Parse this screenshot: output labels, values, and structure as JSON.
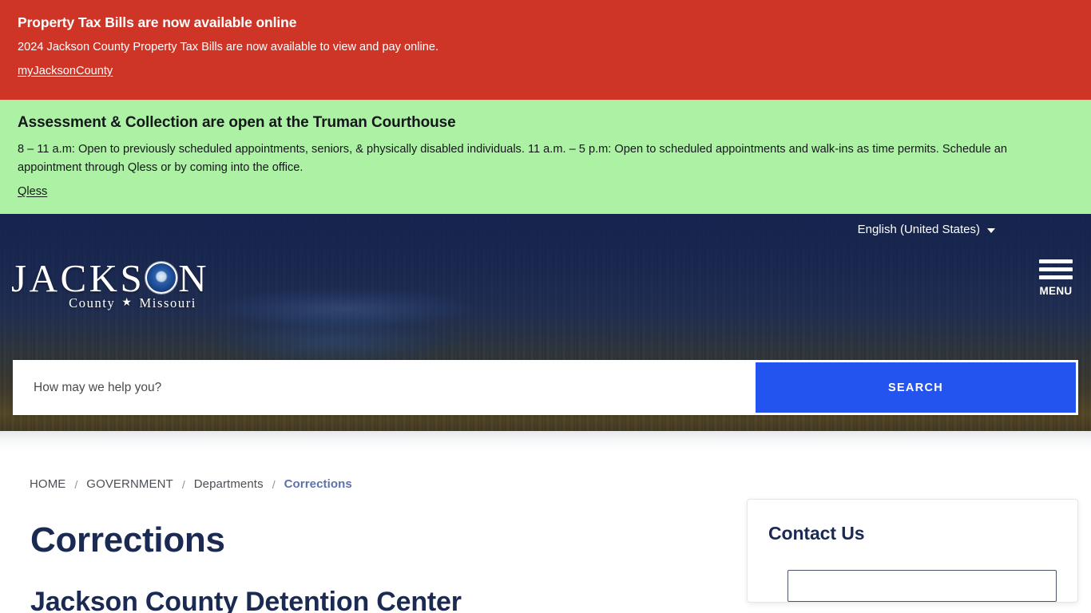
{
  "alerts": [
    {
      "id": "property-tax",
      "title": "Property Tax Bills are now available online",
      "body": "2024 Jackson County Property Tax Bills are now available to view and pay online.",
      "link": "myJacksonCounty",
      "background": "#cf3527",
      "text_color": "#ffffff"
    },
    {
      "id": "assessment-collection",
      "title": "Assessment & Collection are open at the Truman Courthouse",
      "body": "8 – 11 a.m: Open to previously scheduled appointments, seniors, & physically disabled individuals. 11 a.m. – 5 p.m: Open to scheduled appointments and walk-ins as time permits. Schedule an appointment through Qless or by coming into the office.",
      "link": "Qless",
      "background": "#adf2a4",
      "text_color": "#14171a"
    }
  ],
  "header": {
    "language": {
      "selected": "English (United States)",
      "caret_icon": "chevron-down-icon"
    },
    "logo": {
      "word_before_seal": "JACKS",
      "seal_icon": "jackson-county-seal-icon",
      "word_after_seal": "N",
      "subtitle_left": "County",
      "star_icon": "★",
      "subtitle_right": "Missouri"
    },
    "menu": {
      "icon": "hamburger-menu-icon",
      "label": "MENU"
    }
  },
  "search": {
    "placeholder": "How may we help you?",
    "value": "",
    "button_label": "SEARCH",
    "button_color": "#2354f0"
  },
  "breadcrumb": {
    "items": [
      {
        "label": "HOME",
        "current": false
      },
      {
        "label": "GOVERNMENT",
        "current": false
      },
      {
        "label": "Departments",
        "current": false
      },
      {
        "label": "Corrections",
        "current": true
      }
    ],
    "separator": "/"
  },
  "main": {
    "page_title": "Corrections",
    "section_title": "Jackson County Detention Center"
  },
  "sidebar": {
    "contact_card": {
      "title": "Contact Us"
    }
  },
  "theme": {
    "navy": "#1b2a52",
    "hero_overlay": "#17234d",
    "breadcrumb_active": "#5d72ab",
    "accent_blue": "#2354f0"
  }
}
